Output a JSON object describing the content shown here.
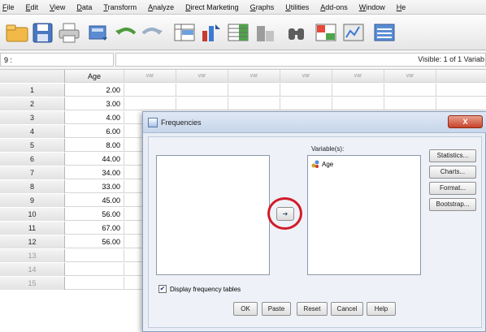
{
  "menu": [
    "File",
    "Edit",
    "View",
    "Data",
    "Transform",
    "Analyze",
    "Direct Marketing",
    "Graphs",
    "Utilities",
    "Add-ons",
    "Window",
    "He"
  ],
  "toolbar_icons": [
    "open-folder-icon",
    "save-icon",
    "print-icon",
    "dialog-recall-icon",
    "undo-icon",
    "redo-icon",
    "goto-case-icon",
    "goto-variable-icon",
    "variables-icon",
    "chart-icon",
    "find-icon",
    "insert-cases-icon",
    "split-file-icon",
    "value-labels-icon"
  ],
  "cellbar": {
    "reference": "9 :",
    "visible": "Visible: 1 of 1 Variab"
  },
  "grid": {
    "columns": [
      "Age",
      "var",
      "var",
      "var",
      "var",
      "var",
      "var"
    ],
    "rows": [
      {
        "num": "1",
        "age": "2.00"
      },
      {
        "num": "2",
        "age": "3.00"
      },
      {
        "num": "3",
        "age": "4.00"
      },
      {
        "num": "4",
        "age": "6.00"
      },
      {
        "num": "5",
        "age": "8.00"
      },
      {
        "num": "6",
        "age": "44.00"
      },
      {
        "num": "7",
        "age": "34.00"
      },
      {
        "num": "8",
        "age": "33.00"
      },
      {
        "num": "9",
        "age": "45.00"
      },
      {
        "num": "10",
        "age": "56.00"
      },
      {
        "num": "11",
        "age": "67.00"
      },
      {
        "num": "12",
        "age": "56.00"
      },
      {
        "num": "13",
        "age": ""
      },
      {
        "num": "14",
        "age": ""
      },
      {
        "num": "15",
        "age": ""
      }
    ]
  },
  "dialog": {
    "title": "Frequencies",
    "close_label": "X",
    "variables_label": "Variable(s):",
    "selected_variable": "Age",
    "move_arrow": "➔",
    "side_buttons": [
      "Statistics...",
      "Charts...",
      "Format...",
      "Bootstrap..."
    ],
    "checkbox_label": "Display frequency tables",
    "checkbox_checked": true,
    "bottom_buttons": [
      "OK",
      "Paste",
      "Reset",
      "Cancel",
      "Help"
    ]
  },
  "colors": {
    "highlight_circle": "#d21b2a",
    "dialog_bg": "#e9eef6"
  }
}
